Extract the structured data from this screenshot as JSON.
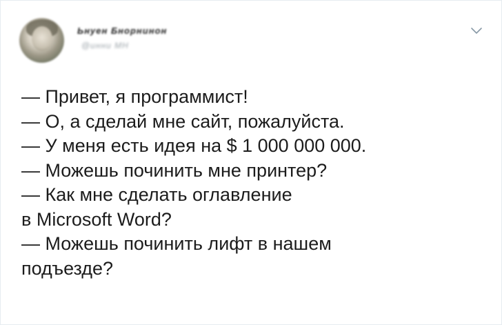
{
  "tweet": {
    "author_name": "Ьнуен Бнорнинон",
    "author_handle": "@инни МН",
    "menu_icon": "chevron-down-icon",
    "lines": [
      "— Привет, я программист!",
      "— О, а сделай мне сайт, пожалуйста.",
      "— У меня есть идея на $ 1 000 000 000.",
      "— Можешь починить мне принтер?",
      "— Как мне сделать оглавление",
      "в Microsoft Word?",
      "— Можешь починить лифт в нашем",
      "подъезде?"
    ]
  },
  "colors": {
    "text": "#1c1c1c",
    "muted": "#9aa2a8",
    "border": "#e6ecf0",
    "chevron": "#8899a6"
  }
}
